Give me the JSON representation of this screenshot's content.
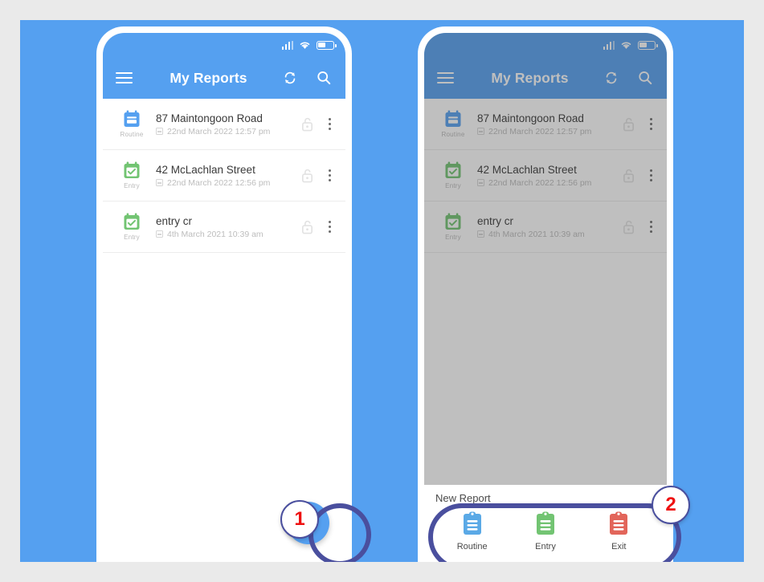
{
  "canvas": {
    "background_color": "#eaeaea",
    "stage_color": "#55a0f0"
  },
  "status_bar": {
    "signal_icon": "signal-bars-icon",
    "wifi_icon": "wifi-icon",
    "battery_icon": "battery-icon"
  },
  "app_bar": {
    "menu_icon": "hamburger-menu-icon",
    "title": "My Reports",
    "refresh_icon": "refresh-sync-icon",
    "search_icon": "search-icon"
  },
  "reports": [
    {
      "type_label": "Routine",
      "type_icon": "clipboard-lines-icon",
      "type_color": "#55a0f0",
      "title": "87 Maintongoon Road",
      "date": "22nd March 2022 12:57 pm",
      "date_icon": "calendar-icon",
      "lock_icon": "unlocked-padlock-icon",
      "menu_icon": "overflow-menu-icon"
    },
    {
      "type_label": "Entry",
      "type_icon": "clipboard-check-icon",
      "type_color": "#72c472",
      "title": "42 McLachlan Street",
      "date": "22nd March 2022 12:56 pm",
      "date_icon": "calendar-icon",
      "lock_icon": "unlocked-padlock-icon",
      "menu_icon": "overflow-menu-icon"
    },
    {
      "type_label": "Entry",
      "type_icon": "clipboard-check-icon",
      "type_color": "#72c472",
      "title": "entry cr",
      "date": "4th March 2021 10:39 am",
      "date_icon": "calendar-icon",
      "lock_icon": "unlocked-padlock-icon",
      "menu_icon": "overflow-menu-icon"
    }
  ],
  "fab": {
    "icon": "plus-icon",
    "color": "#55a0f0"
  },
  "bottom_sheet": {
    "title": "New Report",
    "actions": [
      {
        "label": "Routine",
        "icon": "clipboard-icon",
        "color": "#5aa9e6"
      },
      {
        "label": "Entry",
        "icon": "clipboard-icon",
        "color": "#72c472"
      },
      {
        "label": "Exit",
        "icon": "clipboard-icon",
        "color": "#e2655a"
      }
    ]
  },
  "annotations": {
    "ring_color": "#4a4f9e",
    "number_color": "#ee1111",
    "markers": [
      {
        "number": "1"
      },
      {
        "number": "2"
      }
    ]
  }
}
